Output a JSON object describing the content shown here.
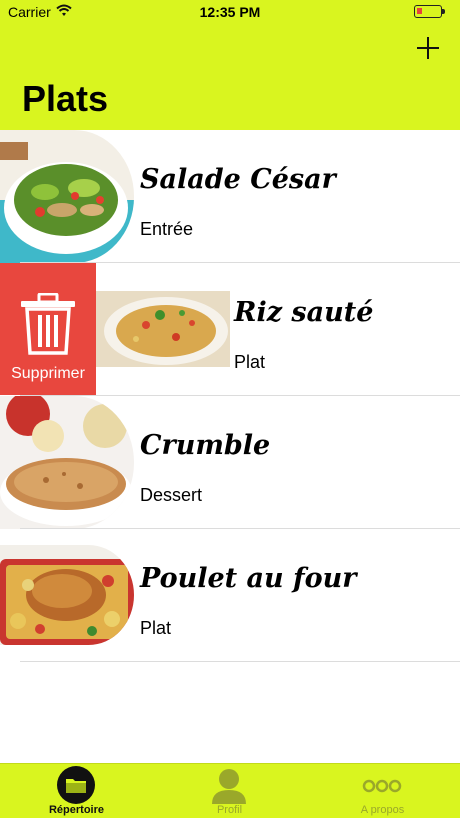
{
  "status_bar": {
    "carrier": "Carrier",
    "time": "12:35 PM"
  },
  "header": {
    "title": "Plats",
    "add_icon": "plus-icon"
  },
  "dishes": [
    {
      "name": "Salade César",
      "category": "Entrée"
    },
    {
      "name": "Riz sauté",
      "category": "Plat"
    },
    {
      "name": "Crumble",
      "category": "Dessert"
    },
    {
      "name": "Poulet au four",
      "category": "Plat"
    }
  ],
  "swipe_action": {
    "label": "Supprimer",
    "icon": "trash-icon",
    "color": "#e8473e"
  },
  "tabbar": {
    "items": [
      {
        "label": "Répertoire",
        "icon": "folder-icon",
        "active": true
      },
      {
        "label": "Profil",
        "icon": "person-icon",
        "active": false
      },
      {
        "label": "A propos",
        "icon": "more-dots-icon",
        "active": false
      }
    ]
  },
  "colors": {
    "accent": "#d9f51f",
    "delete": "#e8473e"
  }
}
